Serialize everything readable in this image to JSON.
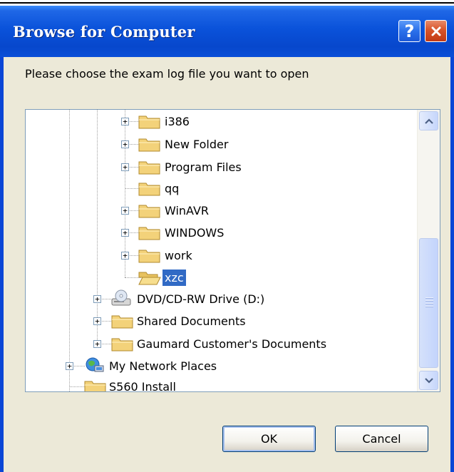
{
  "dialog": {
    "title": "Browse for Computer",
    "help_label": "?",
    "close_label": "✕",
    "prompt": "Please choose the exam log file you want to open"
  },
  "tree": {
    "items": [
      {
        "label": "i386",
        "icon": "folder-icon",
        "expandable": true,
        "selected": false
      },
      {
        "label": "New Folder",
        "icon": "folder-icon",
        "expandable": true,
        "selected": false
      },
      {
        "label": "Program Files",
        "icon": "folder-icon",
        "expandable": true,
        "selected": false
      },
      {
        "label": "qq",
        "icon": "folder-icon",
        "expandable": false,
        "selected": false
      },
      {
        "label": "WinAVR",
        "icon": "folder-icon",
        "expandable": true,
        "selected": false
      },
      {
        "label": "WINDOWS",
        "icon": "folder-icon",
        "expandable": true,
        "selected": false
      },
      {
        "label": "work",
        "icon": "folder-icon",
        "expandable": true,
        "selected": false
      },
      {
        "label": "xzc",
        "icon": "open-folder-icon",
        "expandable": false,
        "selected": true
      },
      {
        "label": "DVD/CD-RW Drive (D:)",
        "icon": "cd-drive-icon",
        "expandable": true,
        "selected": false
      },
      {
        "label": "Shared Documents",
        "icon": "folder-icon",
        "expandable": true,
        "selected": false
      },
      {
        "label": "Gaumard Customer's Documents",
        "icon": "folder-icon",
        "expandable": true,
        "selected": false
      },
      {
        "label": "My Network Places",
        "icon": "network-places-icon",
        "expandable": true,
        "selected": false
      },
      {
        "label": "S560 Install",
        "icon": "folder-icon",
        "expandable": false,
        "selected": false
      }
    ],
    "expand_symbol": "+"
  },
  "buttons": {
    "ok_label": "OK",
    "cancel_label": "Cancel"
  },
  "colors": {
    "selection": "#316ac5",
    "titlebar": "#0a52da"
  }
}
